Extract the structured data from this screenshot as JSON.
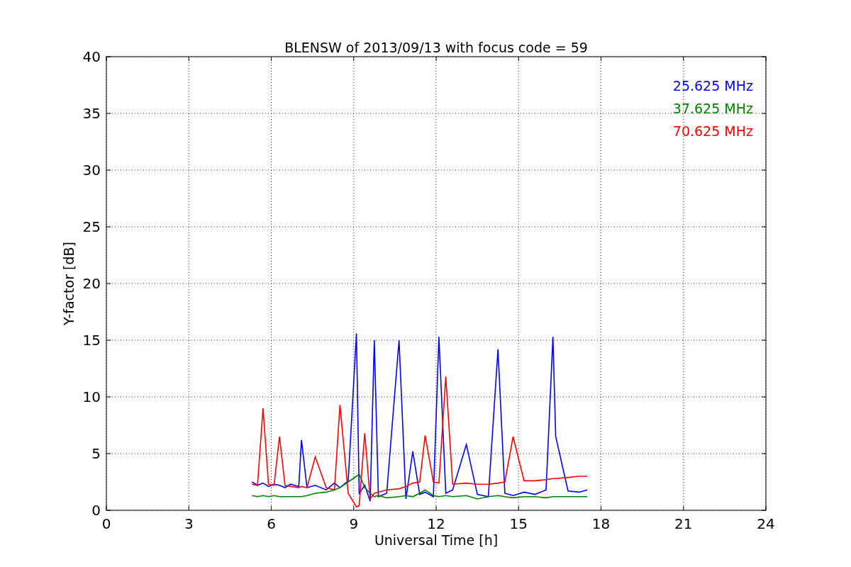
{
  "figure": {
    "chart_data": {
      "type": "line",
      "title": "BLENSW of 2013/09/13 with focus code = 59",
      "xlabel": "Universal Time [h]",
      "ylabel": "Y-factor [dB]",
      "x": [
        5.3,
        5.5,
        5.7,
        5.9,
        6.1,
        6.3,
        6.5,
        6.7,
        7.0,
        7.1,
        7.3,
        7.6,
        8.0,
        8.3,
        8.5,
        8.8,
        9.1,
        9.2,
        9.4,
        9.6,
        9.75,
        9.9,
        10.2,
        10.65,
        10.9,
        11.15,
        11.4,
        11.6,
        11.9,
        12.1,
        12.35,
        12.6,
        13.1,
        13.5,
        13.9,
        14.25,
        14.5,
        14.8,
        15.2,
        15.6,
        16.0,
        16.25,
        16.35,
        16.8,
        17.2,
        17.5
      ],
      "series": [
        {
          "name": "25.625 MHz",
          "color": "#0000ff",
          "values": [
            2.5,
            2.2,
            2.4,
            2.1,
            2.3,
            2.2,
            2.0,
            2.3,
            2.1,
            6.2,
            2.0,
            2.2,
            1.8,
            2.4,
            2.0,
            2.6,
            15.6,
            1.5,
            2.2,
            0.8,
            15.0,
            1.2,
            1.5,
            15.0,
            1.0,
            5.2,
            1.4,
            1.6,
            1.2,
            15.3,
            1.5,
            1.8,
            5.8,
            1.4,
            1.2,
            14.2,
            1.5,
            1.3,
            1.6,
            1.4,
            1.8,
            15.3,
            6.5,
            1.7,
            1.6,
            1.8
          ]
        },
        {
          "name": "37.625 MHz",
          "color": "#008000",
          "values": [
            1.3,
            1.2,
            1.3,
            1.2,
            1.3,
            1.2,
            1.2,
            1.2,
            1.2,
            1.2,
            1.3,
            1.5,
            1.6,
            1.8,
            2.0,
            2.5,
            3.0,
            3.2,
            2.0,
            1.5,
            1.2,
            1.3,
            1.1,
            1.2,
            1.3,
            1.2,
            1.5,
            1.8,
            1.3,
            1.2,
            1.3,
            1.2,
            1.3,
            1.0,
            1.2,
            1.3,
            1.2,
            1.1,
            1.2,
            1.2,
            1.1,
            1.2,
            1.2,
            1.2,
            1.2,
            1.2
          ]
        },
        {
          "name": "70.625 MHz",
          "color": "#ff0000",
          "values": [
            2.3,
            2.2,
            9.0,
            2.3,
            2.2,
            6.5,
            2.2,
            2.1,
            2.0,
            2.1,
            2.0,
            4.7,
            2.0,
            1.8,
            9.3,
            1.5,
            0.3,
            0.4,
            6.8,
            1.0,
            1.5,
            1.6,
            1.8,
            1.9,
            2.1,
            2.4,
            2.5,
            6.6,
            2.5,
            2.4,
            11.8,
            2.3,
            2.4,
            2.3,
            2.3,
            2.4,
            2.5,
            6.5,
            2.6,
            2.6,
            2.7,
            2.8,
            2.8,
            2.9,
            3.0,
            3.0
          ]
        }
      ],
      "xlim": [
        0,
        24
      ],
      "ylim": [
        0,
        40
      ],
      "xticks": [
        0,
        3,
        6,
        9,
        12,
        15,
        18,
        21,
        24
      ],
      "yticks": [
        0,
        5,
        10,
        15,
        20,
        25,
        30,
        35,
        40
      ],
      "grid": true
    }
  }
}
